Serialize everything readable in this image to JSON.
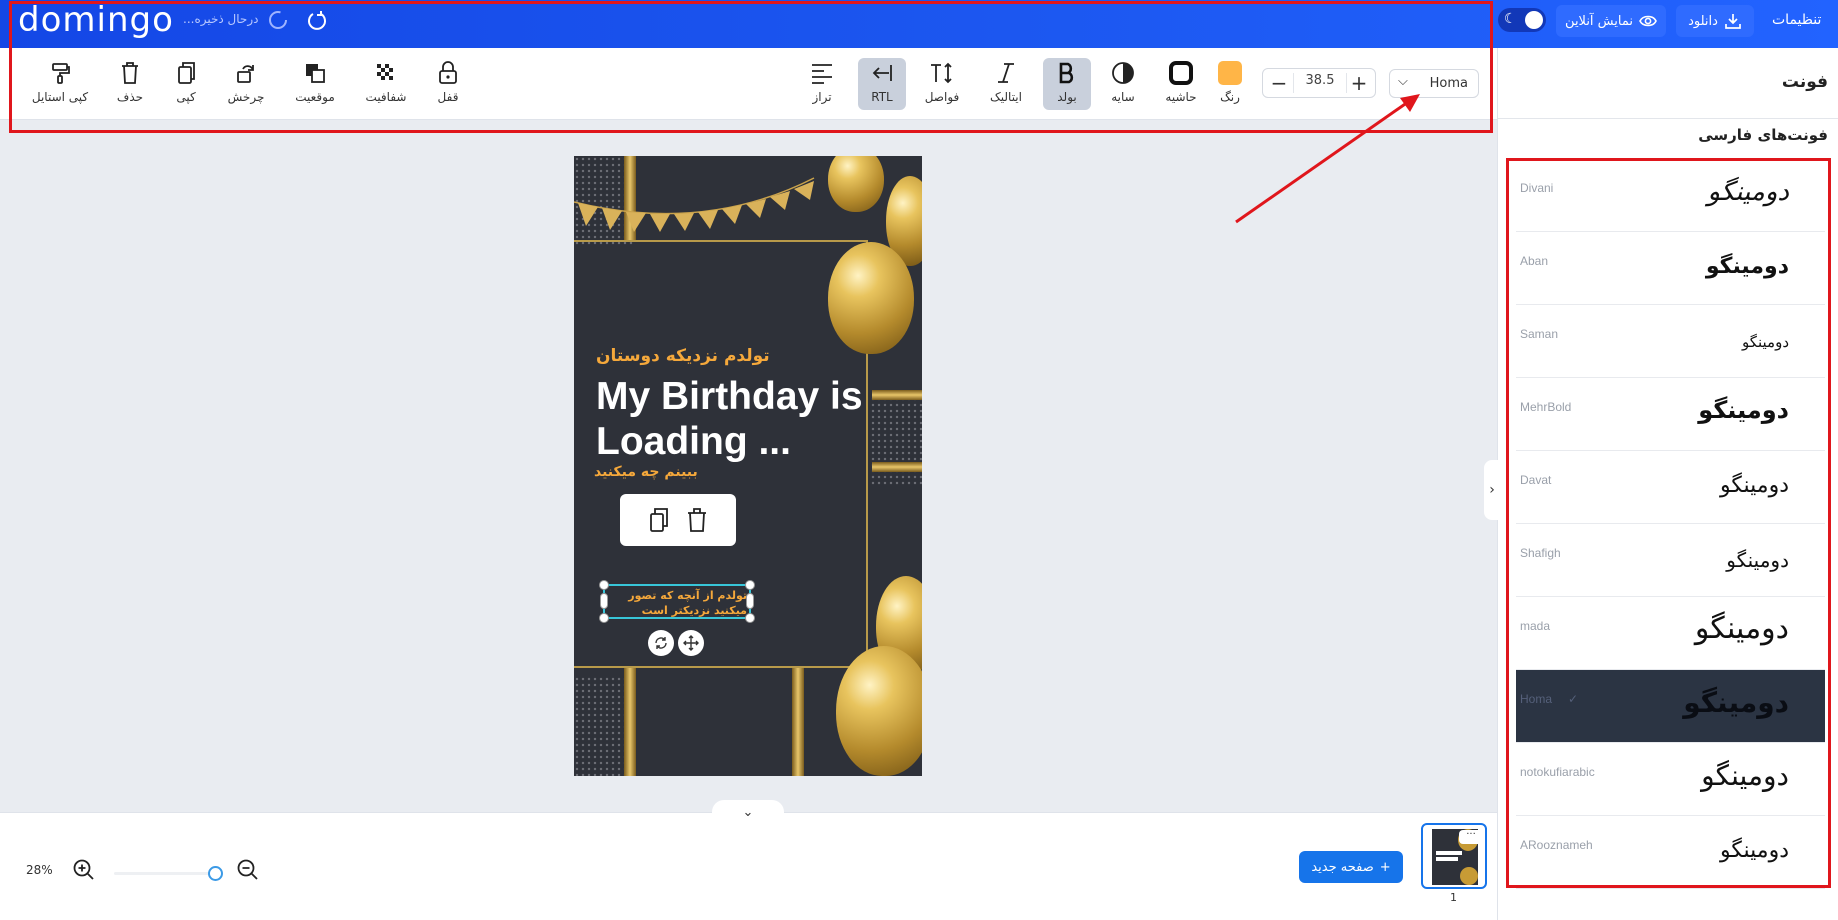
{
  "app": {
    "logo": "domingo",
    "saving_status": "در‌حال ذخیره..."
  },
  "topbar": {
    "settings": "تنظیمات",
    "download": "دانلود",
    "preview": "نمایش آنلاین"
  },
  "toolbar": {
    "font_name": "Homa",
    "font_size": "38.5",
    "tools": {
      "color": "رنگ",
      "border": "حاشیه",
      "shadow": "سایه",
      "bold": "بولد",
      "italic": "ایتالیک",
      "spacing": "فواصل",
      "rtl": "RTL",
      "align": "تراز",
      "lock": "قفل",
      "opacity": "شفافیت",
      "position": "موقعیت",
      "rotate": "چرخش",
      "copy": "کپی",
      "delete": "حذف",
      "copy_style": "کپی استایل"
    },
    "color_value": "#ffb547"
  },
  "panel": {
    "title": "فونت",
    "subtitle": "فونت‌های فارسی",
    "fonts": [
      {
        "name": "Divani",
        "preview": "دومینگو"
      },
      {
        "name": "Aban",
        "preview": "دومینگو"
      },
      {
        "name": "Saman",
        "preview": "دومینگو"
      },
      {
        "name": "MehrBold",
        "preview": "دومینگو"
      },
      {
        "name": "Davat",
        "preview": "دومینگو"
      },
      {
        "name": "Shafigh",
        "preview": "دومینگو"
      },
      {
        "name": "mada",
        "preview": "دومینگو"
      },
      {
        "name": "Homa",
        "preview": "دومینگو",
        "selected": true
      },
      {
        "name": "notokufiarabic",
        "preview": "دومینگو"
      },
      {
        "name": "ARooznameh",
        "preview": "دومینگو"
      }
    ]
  },
  "canvas": {
    "line_fa_top": "تولدم نزدیکه دوستان",
    "title": "My Birthday is Loading ...",
    "line_fa_sub": "ببینم چه میکنید",
    "selected_text": "تولدم از آنچه که تصور میکنید نزدیکتر است"
  },
  "bottom": {
    "zoom": "28%",
    "zoom_level": 0.9,
    "new_page": "صفحه جدید",
    "page_number": "1",
    "more": "···"
  },
  "colors": {
    "brand_blue": "#1c57f0",
    "accent_orange": "#f5a83b",
    "annotation_red": "#e0161c",
    "selected_font_bg": "#2b3443"
  }
}
